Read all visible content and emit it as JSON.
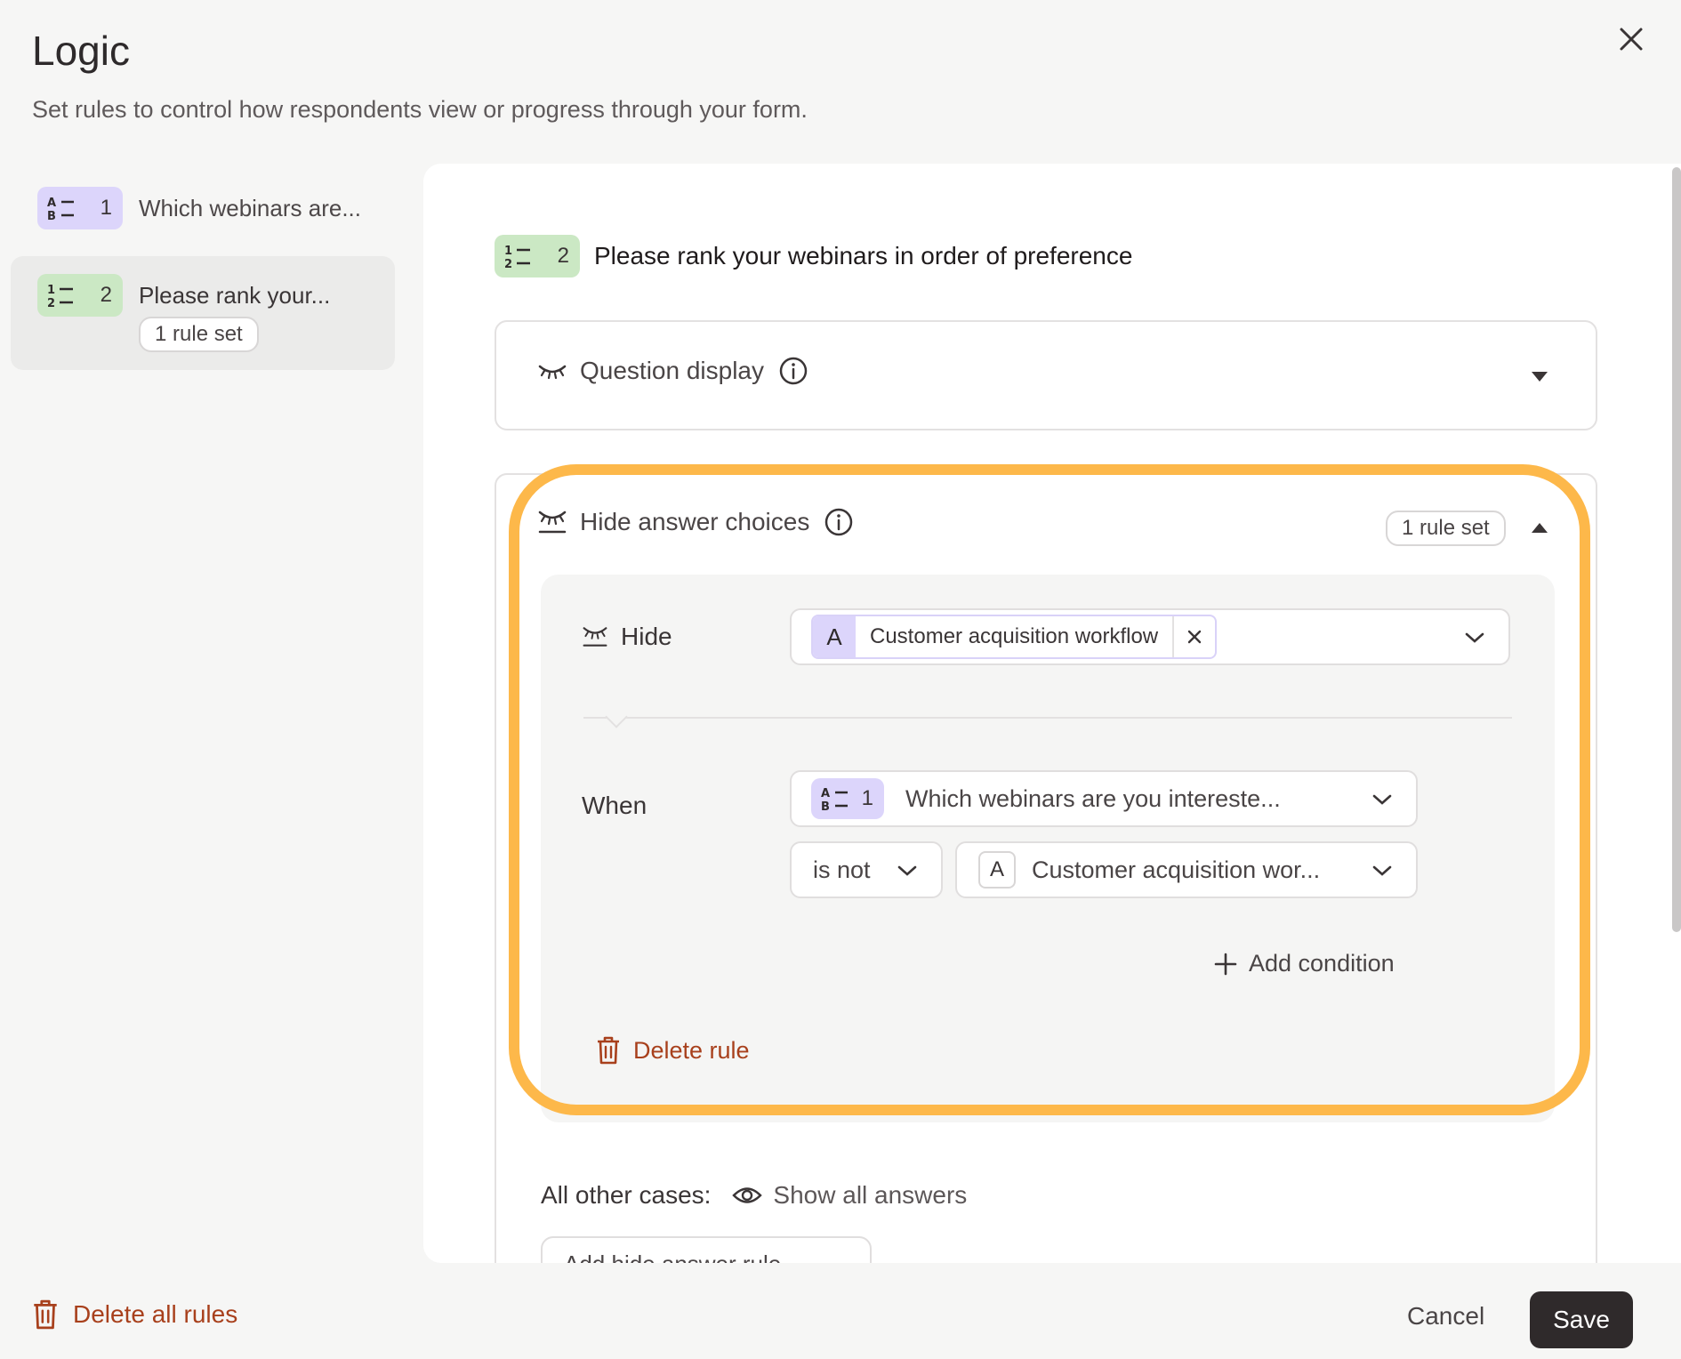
{
  "header": {
    "title": "Logic",
    "subtitle": "Set rules to control how respondents view or progress through your form."
  },
  "sidebar": {
    "items": [
      {
        "number": "1",
        "label": "Which webinars are...",
        "type_icon": "abc-list-icon"
      },
      {
        "number": "2",
        "label": "Please rank your...",
        "type_icon": "ranking-icon",
        "badge": "1 rule set"
      }
    ]
  },
  "question": {
    "number": "2",
    "text": "Please rank your webinars in order of preference"
  },
  "question_display": {
    "label": "Question display"
  },
  "hide_answer_choices": {
    "label": "Hide answer choices",
    "badge": "1 rule set",
    "rule": {
      "hide_label": "Hide",
      "hide_chip": {
        "letter": "A",
        "text": "Customer acquisition workflow"
      },
      "when_label": "When",
      "when_question": {
        "number": "1",
        "text": "Which webinars are you intereste..."
      },
      "operator": "is not",
      "answer": {
        "letter": "A",
        "text": "Customer acquisition wor..."
      },
      "add_condition": "Add condition",
      "delete_rule": "Delete rule"
    },
    "other_cases_label": "All other cases:",
    "other_cases_value": "Show all answers",
    "add_rule_button": "Add hide answer rule"
  },
  "footer": {
    "delete_all": "Delete all rules",
    "cancel": "Cancel",
    "save": "Save"
  },
  "colors": {
    "accent_highlight": "#fdb84a",
    "purple_badge": "#dcd5fb",
    "green_badge": "#cbe8c4",
    "danger": "#a8401c",
    "primary_button": "#2f2a2b"
  }
}
